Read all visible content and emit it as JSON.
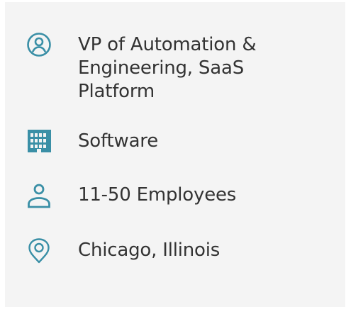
{
  "profile": {
    "items": [
      {
        "icon": "user-circle-icon",
        "label": "VP of Automation & Engineering, SaaS Platform"
      },
      {
        "icon": "building-icon",
        "label": "Software"
      },
      {
        "icon": "person-icon",
        "label": "11-50 Employees"
      },
      {
        "icon": "location-pin-icon",
        "label": "Chicago, Illinois"
      }
    ]
  },
  "colors": {
    "icon": "#3a8fa6",
    "text": "#333333",
    "card_background": "#f4f4f4"
  }
}
